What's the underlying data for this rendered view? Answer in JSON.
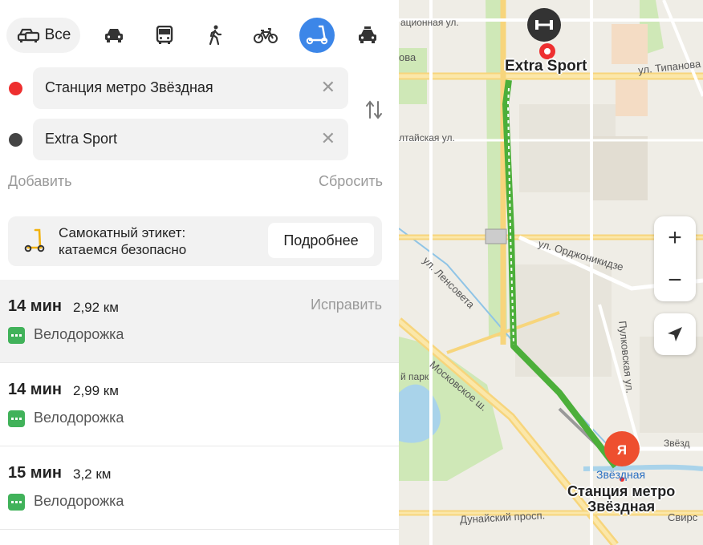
{
  "transport_modes": {
    "all_label": "Все",
    "items": [
      {
        "name": "car",
        "icon": "car-icon"
      },
      {
        "name": "bus",
        "icon": "bus-icon"
      },
      {
        "name": "pedestrian",
        "icon": "walk-icon"
      },
      {
        "name": "bicycle",
        "icon": "bicycle-icon"
      },
      {
        "name": "scooter",
        "icon": "scooter-icon",
        "active": true
      },
      {
        "name": "taxi",
        "icon": "taxi-icon"
      }
    ],
    "active_color": "#3c86e8"
  },
  "route_form": {
    "from": {
      "value": "Станция метро Звёздная",
      "clear_icon": "✕",
      "dot_color": "#ee2f2f"
    },
    "to": {
      "value": "Extra Sport",
      "clear_icon": "✕",
      "dot_color": "#444444"
    },
    "swap_icon": "swap-icon",
    "add_label": "Добавить",
    "reset_label": "Сбросить"
  },
  "etiquette_banner": {
    "line1": "Самокатный этикет:",
    "line2": "катаемся безопасно",
    "button": "Подробнее",
    "icon": "scooter-icon"
  },
  "routes": [
    {
      "time": "14 мин",
      "distance": "2,92 км",
      "type": "Велодорожка",
      "fix_label": "Исправить",
      "selected": true
    },
    {
      "time": "14 мин",
      "distance": "2,99 км",
      "type": "Велодорожка",
      "selected": false
    },
    {
      "time": "15 мин",
      "distance": "3,2 км",
      "type": "Велодорожка",
      "selected": false
    }
  ],
  "map": {
    "destination_label": "Extra Sport",
    "origin_label_line1": "Станция метро",
    "origin_label_line2": "Звёздная",
    "metro_label": "Звёздная",
    "streets": {
      "s1": "ационная ул.",
      "s2": "ул. Ти",
      "s3": "ова",
      "s4": "ул. Типанова",
      "s5": "лтайская ул.",
      "s6": "ул. Орджоникидзе",
      "s7": "ул. Ленсовета",
      "s8": "Московское ш.",
      "s9": "Пулковская ул.",
      "s10": "Дунайский просп.",
      "s11": "Московс",
      "s12": "Свирс",
      "s13": "Звёзд",
      "s14": "й парк",
      "s15": "Ленсовета",
      "s16": "Я"
    },
    "zoom_in": "+",
    "zoom_out": "−",
    "route_color": "#4caf3a",
    "locate_icon": "navigation-arrow-icon"
  }
}
